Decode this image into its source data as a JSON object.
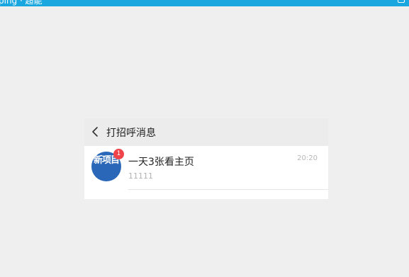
{
  "window": {
    "title": "ping · 超能",
    "accent_color": "#1aa7e0",
    "control_icon": "window-control-icon"
  },
  "header": {
    "back_icon": "chevron-left-icon",
    "title": "打招呼消息"
  },
  "messages": [
    {
      "avatar_text": "新项目",
      "avatar_color": "#2a67b8",
      "badge": "1",
      "badge_color": "#f0444a",
      "title": "一天3张看主页",
      "preview": "11111",
      "time": "20:20"
    }
  ]
}
